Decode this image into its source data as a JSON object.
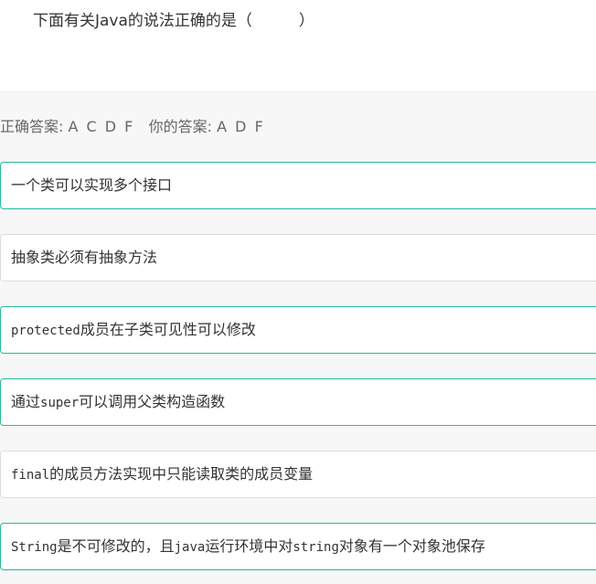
{
  "question": {
    "title": "下面有关Java的说法正确的是（　　　）"
  },
  "answer": {
    "correct_label": "正确答案: ",
    "correct_value": "A C D F",
    "yours_label": "你的答案: ",
    "yours_value": "A D F"
  },
  "options": [
    {
      "parts": [
        {
          "t": "一个类可以实现多个接口"
        }
      ],
      "checked": true
    },
    {
      "parts": [
        {
          "t": "抽象类必须有抽象方法"
        }
      ],
      "checked": false
    },
    {
      "parts": [
        {
          "t": "protected",
          "code": true
        },
        {
          "t": "成员在子类可见性可以修改"
        }
      ],
      "checked": true
    },
    {
      "parts": [
        {
          "t": "通过"
        },
        {
          "t": "super",
          "code": true
        },
        {
          "t": "可以调用父类构造函数"
        }
      ],
      "checked": true
    },
    {
      "parts": [
        {
          "t": "final",
          "code": true
        },
        {
          "t": "的成员方法实现中只能读取类的成员变量"
        }
      ],
      "checked": false
    },
    {
      "parts": [
        {
          "t": "String",
          "code": true
        },
        {
          "t": "是不可修改的，且"
        },
        {
          "t": "java",
          "code": true
        },
        {
          "t": "运行环境中对"
        },
        {
          "t": "string",
          "code": true
        },
        {
          "t": "对象有一个对象池保存"
        }
      ],
      "checked": true
    }
  ],
  "colors": {
    "checked_border": "#25bb9b",
    "unchecked_border": "#dddddd",
    "answer_background": "#f7f7f7"
  }
}
